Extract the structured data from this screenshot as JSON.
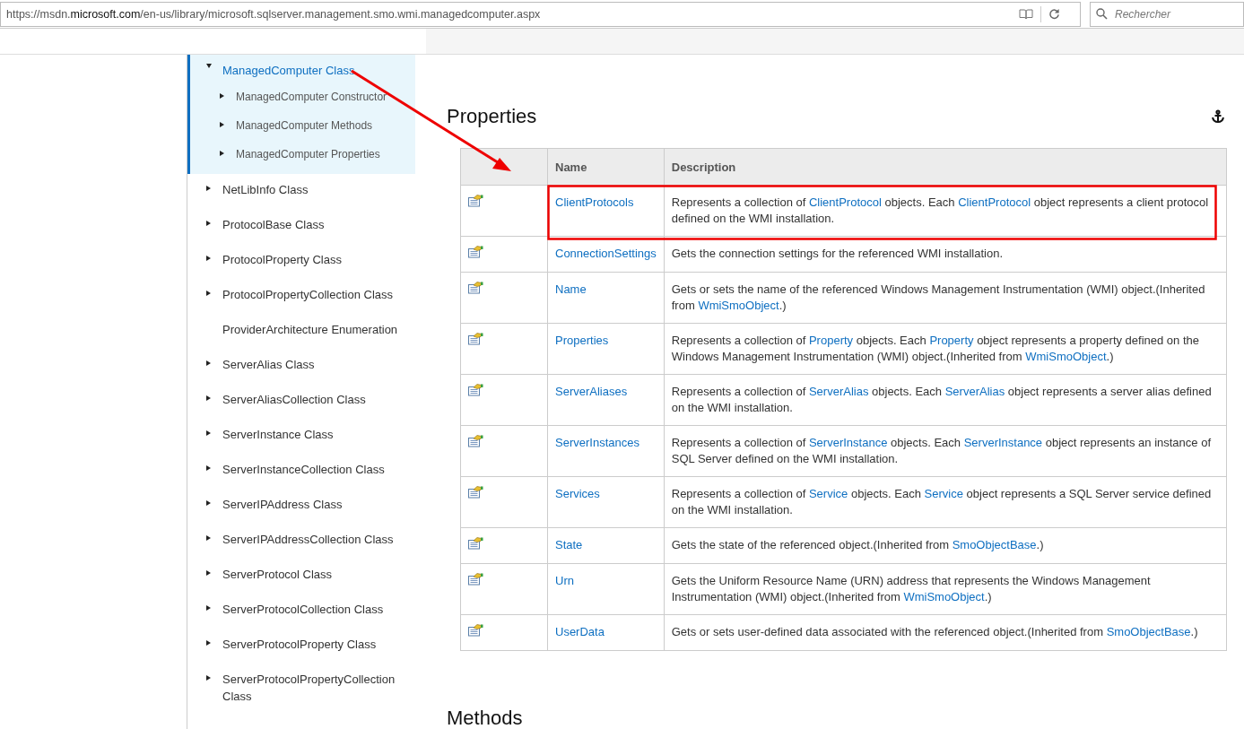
{
  "browser": {
    "url": "https://msdn.**microsoft.com**/en-us/library/microsoft.sqlserver.management.smo.wmi.managedcomputer.aspx",
    "search": {
      "placeholder": "Rechercher"
    }
  },
  "sidebar": {
    "items": [
      {
        "label": "ManagedComputer Class",
        "kind": "branch",
        "expanded": true,
        "selected": true,
        "children": [
          {
            "label": "ManagedComputer Constructor",
            "kind": "branch",
            "expanded": false,
            "selected": false
          },
          {
            "label": "ManagedComputer Methods",
            "kind": "branch",
            "expanded": false,
            "selected": false
          },
          {
            "label": "ManagedComputer Properties",
            "kind": "branch",
            "expanded": false,
            "selected": false
          }
        ]
      },
      {
        "label": "NetLibInfo Class",
        "kind": "branch",
        "expanded": false,
        "selected": false
      },
      {
        "label": "ProtocolBase Class",
        "kind": "branch",
        "expanded": false,
        "selected": false
      },
      {
        "label": "ProtocolProperty Class",
        "kind": "branch",
        "expanded": false,
        "selected": false
      },
      {
        "label": "ProtocolPropertyCollection Class",
        "kind": "branch",
        "expanded": false,
        "selected": false
      },
      {
        "label": "ProviderArchitecture Enumeration",
        "kind": "leaf",
        "selected": false
      },
      {
        "label": "ServerAlias Class",
        "kind": "branch",
        "expanded": false,
        "selected": false
      },
      {
        "label": "ServerAliasCollection Class",
        "kind": "branch",
        "expanded": false,
        "selected": false
      },
      {
        "label": "ServerInstance Class",
        "kind": "branch",
        "expanded": false,
        "selected": false
      },
      {
        "label": "ServerInstanceCollection Class",
        "kind": "branch",
        "expanded": false,
        "selected": false
      },
      {
        "label": "ServerIPAddress Class",
        "kind": "branch",
        "expanded": false,
        "selected": false
      },
      {
        "label": "ServerIPAddressCollection Class",
        "kind": "branch",
        "expanded": false,
        "selected": false
      },
      {
        "label": "ServerProtocol Class",
        "kind": "branch",
        "expanded": false,
        "selected": false
      },
      {
        "label": "ServerProtocolCollection Class",
        "kind": "branch",
        "expanded": false,
        "selected": false
      },
      {
        "label": "ServerProtocolProperty Class",
        "kind": "branch",
        "expanded": false,
        "selected": false
      },
      {
        "label": "ServerProtocolPropertyCollection Class",
        "kind": "branch",
        "expanded": false,
        "selected": false
      }
    ]
  },
  "properties": {
    "heading": "Properties",
    "columns": [
      "Name",
      "Description"
    ],
    "rows": [
      {
        "name": "ClientProtocols",
        "highlighted": true,
        "description": [
          {
            "kind": "text",
            "text": "Represents a collection of "
          },
          {
            "kind": "link",
            "text": "ClientProtocol"
          },
          {
            "kind": "text",
            "text": " objects. Each "
          },
          {
            "kind": "link",
            "text": "ClientProtocol"
          },
          {
            "kind": "text",
            "text": " object represents a client protocol defined on the WMI installation."
          }
        ]
      },
      {
        "name": "ConnectionSettings",
        "highlighted": false,
        "description": [
          {
            "kind": "text",
            "text": "Gets the connection settings for the referenced WMI installation."
          }
        ]
      },
      {
        "name": "Name",
        "highlighted": false,
        "description": [
          {
            "kind": "text",
            "text": "Gets or sets the name of the referenced Windows Management Instrumentation (WMI) object.(Inherited from "
          },
          {
            "kind": "link",
            "text": "WmiSmoObject"
          },
          {
            "kind": "text",
            "text": ".)"
          }
        ]
      },
      {
        "name": "Properties",
        "highlighted": false,
        "description": [
          {
            "kind": "text",
            "text": "Represents a collection of "
          },
          {
            "kind": "link",
            "text": "Property"
          },
          {
            "kind": "text",
            "text": " objects. Each "
          },
          {
            "kind": "link",
            "text": "Property"
          },
          {
            "kind": "text",
            "text": " object represents a property defined on the Windows Management Instrumentation (WMI) object.(Inherited from "
          },
          {
            "kind": "link",
            "text": "WmiSmoObject"
          },
          {
            "kind": "text",
            "text": ".)"
          }
        ]
      },
      {
        "name": "ServerAliases",
        "highlighted": false,
        "description": [
          {
            "kind": "text",
            "text": "Represents a collection of "
          },
          {
            "kind": "link",
            "text": "ServerAlias"
          },
          {
            "kind": "text",
            "text": " objects. Each "
          },
          {
            "kind": "link",
            "text": "ServerAlias"
          },
          {
            "kind": "text",
            "text": " object represents a server alias defined on the WMI installation."
          }
        ]
      },
      {
        "name": "ServerInstances",
        "highlighted": false,
        "description": [
          {
            "kind": "text",
            "text": "Represents a collection of "
          },
          {
            "kind": "link",
            "text": "ServerInstance"
          },
          {
            "kind": "text",
            "text": " objects. Each "
          },
          {
            "kind": "link",
            "text": "ServerInstance"
          },
          {
            "kind": "text",
            "text": " object represents an instance of SQL Server defined on the WMI installation."
          }
        ]
      },
      {
        "name": "Services",
        "highlighted": false,
        "description": [
          {
            "kind": "text",
            "text": "Represents a collection of "
          },
          {
            "kind": "link",
            "text": "Service"
          },
          {
            "kind": "text",
            "text": " objects. Each "
          },
          {
            "kind": "link",
            "text": "Service"
          },
          {
            "kind": "text",
            "text": " object represents a SQL Server service defined on the WMI installation."
          }
        ]
      },
      {
        "name": "State",
        "highlighted": false,
        "description": [
          {
            "kind": "text",
            "text": "Gets the state of the referenced object.(Inherited from "
          },
          {
            "kind": "link",
            "text": "SmoObjectBase"
          },
          {
            "kind": "text",
            "text": ".)"
          }
        ]
      },
      {
        "name": "Urn",
        "highlighted": false,
        "description": [
          {
            "kind": "text",
            "text": "Gets the Uniform Resource Name (URN) address that represents the Windows Management Instrumentation (WMI) object.(Inherited from "
          },
          {
            "kind": "link",
            "text": "WmiSmoObject"
          },
          {
            "kind": "text",
            "text": ".)"
          }
        ]
      },
      {
        "name": "UserData",
        "highlighted": false,
        "description": [
          {
            "kind": "text",
            "text": "Gets or sets user-defined data associated with the referenced object.(Inherited from "
          },
          {
            "kind": "link",
            "text": "SmoObjectBase"
          },
          {
            "kind": "text",
            "text": ".)"
          }
        ]
      }
    ]
  },
  "methods": {
    "heading": "Methods"
  }
}
